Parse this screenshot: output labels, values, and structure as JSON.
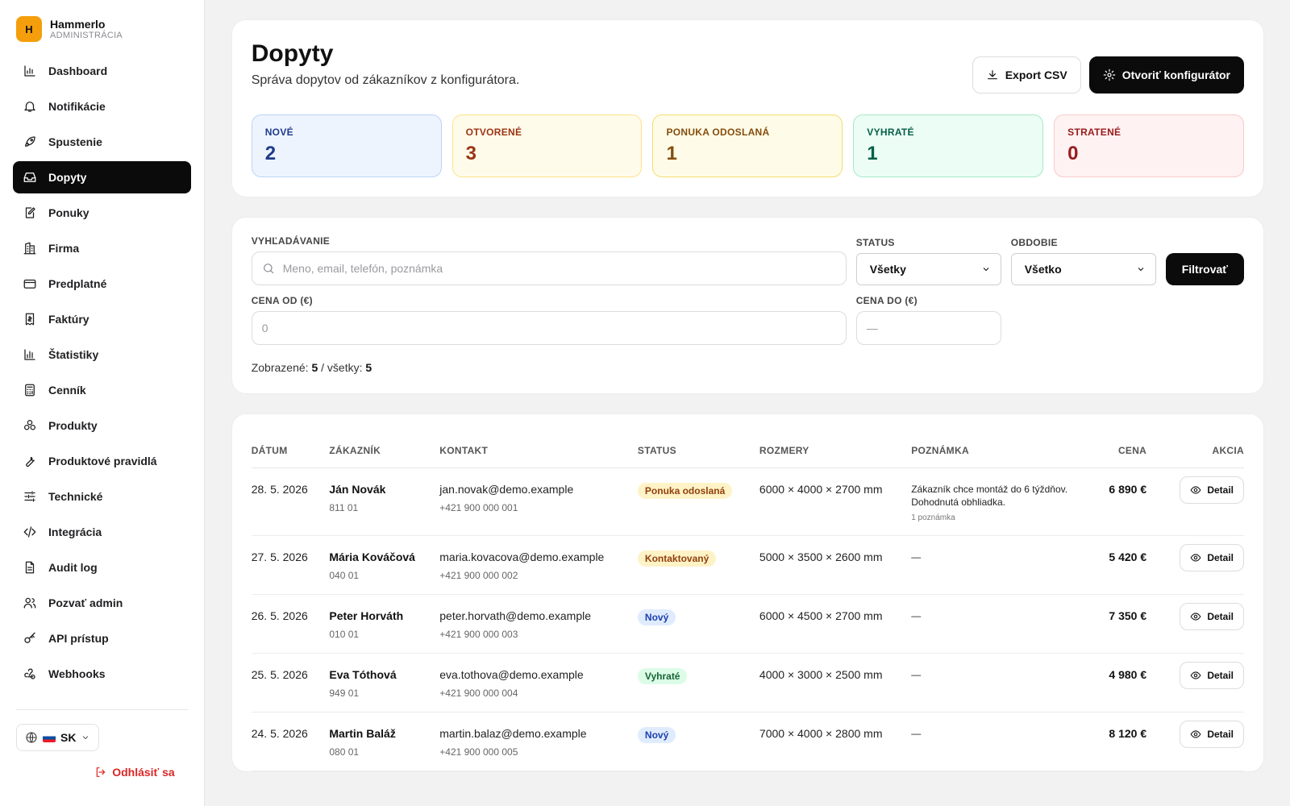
{
  "brand": {
    "logo_letter": "H",
    "name": "Hammerlo",
    "subtitle": "ADMINISTRÁCIA"
  },
  "nav": [
    {
      "label": "Dashboard",
      "icon": "bar-chart-icon",
      "active": false
    },
    {
      "label": "Notifikácie",
      "icon": "bell-icon",
      "active": false
    },
    {
      "label": "Spustenie",
      "icon": "rocket-icon",
      "active": false
    },
    {
      "label": "Dopyty",
      "icon": "inbox-icon",
      "active": true
    },
    {
      "label": "Ponuky",
      "icon": "edit-document-icon",
      "active": false
    },
    {
      "label": "Firma",
      "icon": "building-icon",
      "active": false
    },
    {
      "label": "Predplatné",
      "icon": "credit-card-icon",
      "active": false
    },
    {
      "label": "Faktúry",
      "icon": "invoice-icon",
      "active": false
    },
    {
      "label": "Štatistiky",
      "icon": "stats-icon",
      "active": false
    },
    {
      "label": "Cenník",
      "icon": "calculator-icon",
      "active": false
    },
    {
      "label": "Produkty",
      "icon": "boxes-icon",
      "active": false
    },
    {
      "label": "Produktové pravidlá",
      "icon": "wrench-icon",
      "active": false
    },
    {
      "label": "Technické",
      "icon": "sliders-icon",
      "active": false
    },
    {
      "label": "Integrácia",
      "icon": "code-icon",
      "active": false
    },
    {
      "label": "Audit log",
      "icon": "file-text-icon",
      "active": false
    },
    {
      "label": "Pozvať admin",
      "icon": "users-icon",
      "active": false
    },
    {
      "label": "API prístup",
      "icon": "key-icon",
      "active": false
    },
    {
      "label": "Webhooks",
      "icon": "webhook-icon",
      "active": false
    }
  ],
  "language": {
    "code": "SK"
  },
  "logout_label": "Odhlásiť sa",
  "header": {
    "title": "Dopyty",
    "subtitle": "Správa dopytov od zákazníkov z konfigurátora.",
    "export_label": "Export CSV",
    "configurator_label": "Otvoriť konfigurátor"
  },
  "stats": [
    {
      "label": "NOVÉ",
      "value": "2",
      "bg": "#eef4fe",
      "border": "#bcd3f5",
      "fg": "#1e3a8a"
    },
    {
      "label": "OTVORENÉ",
      "value": "3",
      "bg": "#fffbeb",
      "border": "#fce38a",
      "fg": "#9a3412"
    },
    {
      "label": "PONUKA ODOSLANÁ",
      "value": "1",
      "bg": "#fefce8",
      "border": "#f5dc6d",
      "fg": "#854d0e"
    },
    {
      "label": "VYHRATÉ",
      "value": "1",
      "bg": "#ecfdf5",
      "border": "#a7e8c7",
      "fg": "#065f46"
    },
    {
      "label": "STRATENÉ",
      "value": "0",
      "bg": "#fef2f2",
      "border": "#f8caca",
      "fg": "#991b1b"
    }
  ],
  "filters": {
    "search_label": "VYHĽADÁVANIE",
    "search_placeholder": "Meno, email, telefón, poznámka",
    "status_label": "STATUS",
    "status_value": "Všetky",
    "period_label": "OBDOBIE",
    "period_value": "Všetko",
    "filter_button": "Filtrovať",
    "price_from_label": "CENA OD (€)",
    "price_from_placeholder": "0",
    "price_to_label": "CENA DO (€)",
    "price_to_placeholder": "—",
    "shown_label": "Zobrazené:",
    "shown_value": "5",
    "total_label": "/ všetky:",
    "total_value": "5"
  },
  "table": {
    "columns": [
      "DÁTUM",
      "ZÁKAZNÍK",
      "KONTAKT",
      "STATUS",
      "ROZMERY",
      "POZNÁMKA",
      "CENA",
      "AKCIA"
    ],
    "detail_label": "Detail",
    "rows": [
      {
        "date": "28. 5. 2026",
        "name": "Ján Novák",
        "zip": "811 01",
        "email": "jan.novak@demo.example",
        "phone": "+421 900 000 001",
        "status": "Ponuka odoslaná",
        "status_bg": "#fef3c7",
        "status_fg": "#92400e",
        "dims": "6000 × 4000 × 2700 mm",
        "note": "Zákazník chce montáž do 6 týždňov. Dohodnutá obhliadka.",
        "note_count": "1 poznámka",
        "price": "6 890 €"
      },
      {
        "date": "27. 5. 2026",
        "name": "Mária Kováčová",
        "zip": "040 01",
        "email": "maria.kovacova@demo.example",
        "phone": "+421 900 000 002",
        "status": "Kontaktovaný",
        "status_bg": "#fef3c7",
        "status_fg": "#92400e",
        "dims": "5000 × 3500 × 2600 mm",
        "note": "—",
        "note_count": "",
        "price": "5 420 €"
      },
      {
        "date": "26. 5. 2026",
        "name": "Peter Horváth",
        "zip": "010 01",
        "email": "peter.horvath@demo.example",
        "phone": "+421 900 000 003",
        "status": "Nový",
        "status_bg": "#e0ecfd",
        "status_fg": "#1e40af",
        "dims": "6000 × 4500 × 2700 mm",
        "note": "—",
        "note_count": "",
        "price": "7 350 €"
      },
      {
        "date": "25. 5. 2026",
        "name": "Eva Tóthová",
        "zip": "949 01",
        "email": "eva.tothova@demo.example",
        "phone": "+421 900 000 004",
        "status": "Vyhraté",
        "status_bg": "#dcfce7",
        "status_fg": "#166534",
        "dims": "4000 × 3000 × 2500 mm",
        "note": "—",
        "note_count": "",
        "price": "4 980 €"
      },
      {
        "date": "24. 5. 2026",
        "name": "Martin Baláž",
        "zip": "080 01",
        "email": "martin.balaz@demo.example",
        "phone": "+421 900 000 005",
        "status": "Nový",
        "status_bg": "#e0ecfd",
        "status_fg": "#1e40af",
        "dims": "7000 × 4000 × 2800 mm",
        "note": "—",
        "note_count": "",
        "price": "8 120 €"
      }
    ]
  }
}
